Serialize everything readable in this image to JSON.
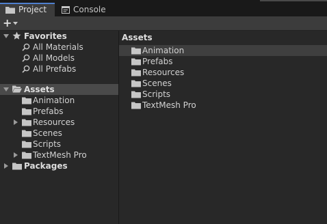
{
  "tabs": [
    {
      "label": "Project",
      "icon": "folder-icon",
      "active": true
    },
    {
      "label": "Console",
      "icon": "console-icon",
      "active": false
    }
  ],
  "toolbar": {
    "add_label": "+"
  },
  "favorites": {
    "label": "Favorites",
    "items": [
      "All Materials",
      "All Models",
      "All Prefabs"
    ]
  },
  "assets": {
    "label": "Assets",
    "children": [
      "Animation",
      "Prefabs",
      "Resources",
      "Scenes",
      "Scripts",
      "TextMesh Pro"
    ]
  },
  "packages": {
    "label": "Packages"
  },
  "main": {
    "title": "Assets",
    "items": [
      "Animation",
      "Prefabs",
      "Resources",
      "Scenes",
      "Scripts",
      "TextMesh Pro"
    ]
  },
  "colors": {
    "accent": "#4f7fcf",
    "folder": "#c6c6c6",
    "background": "#282828"
  }
}
